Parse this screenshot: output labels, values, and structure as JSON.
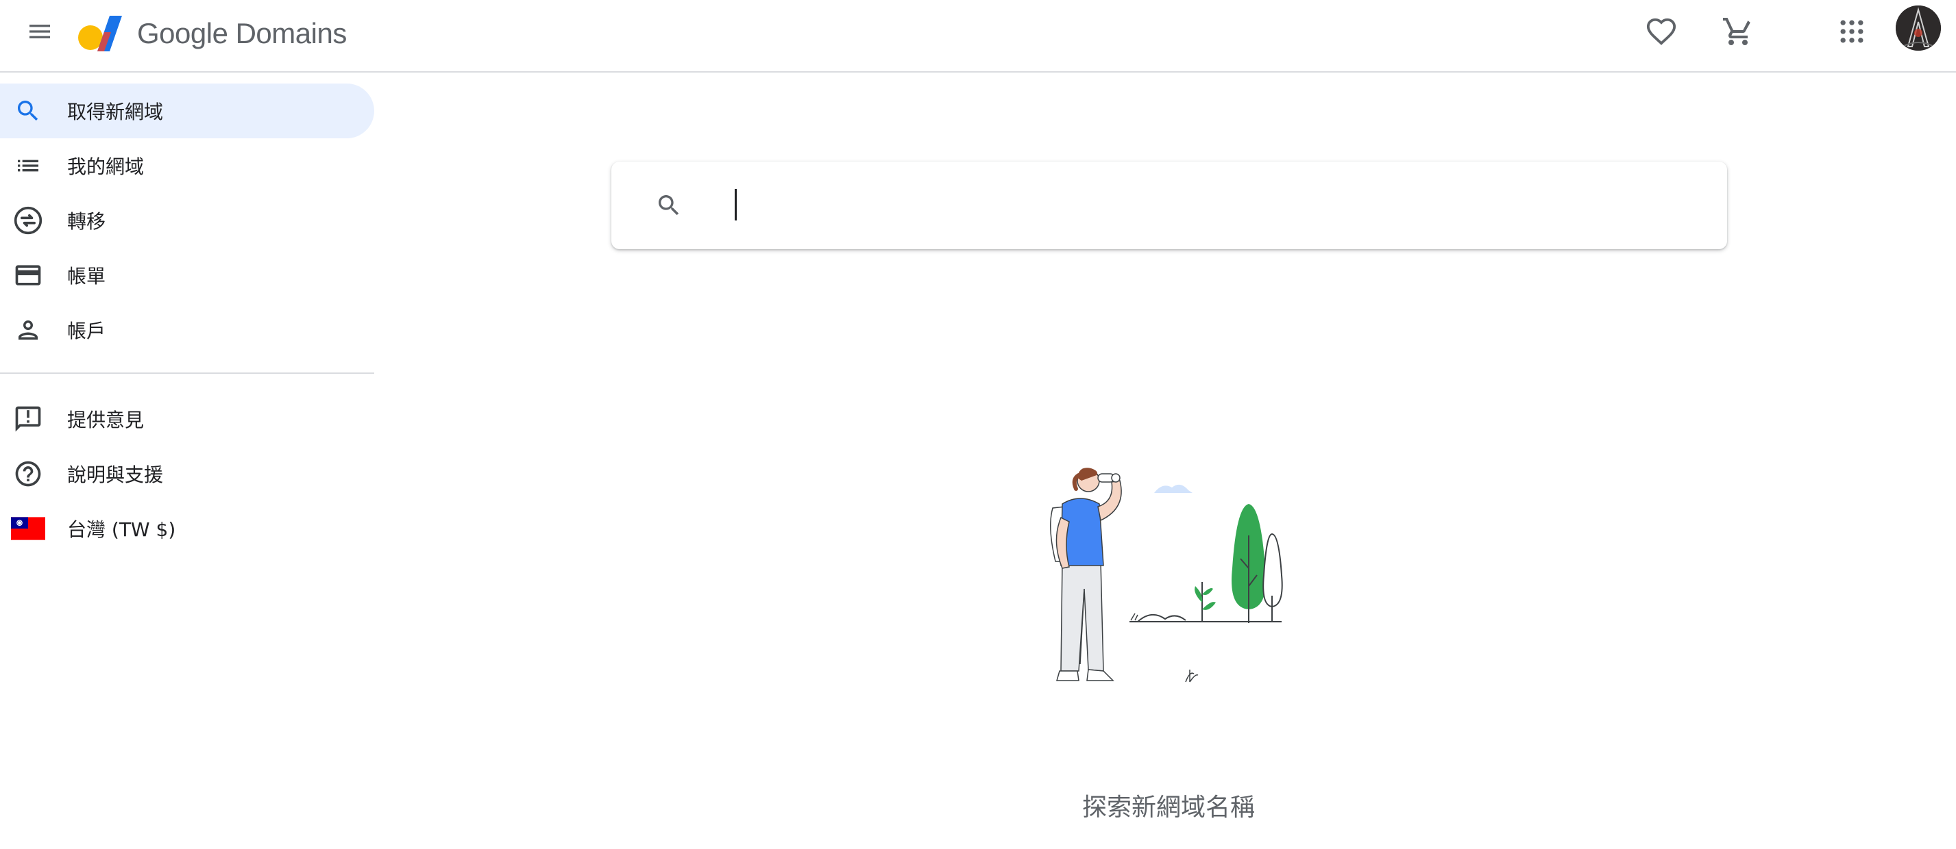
{
  "header": {
    "brand": "Google Domains",
    "icons": {
      "menu": "menu-icon",
      "favorites": "heart-icon",
      "cart": "cart-icon",
      "apps": "apps-grid-icon",
      "avatar": "avatar"
    }
  },
  "sidebar": {
    "items": [
      {
        "label": "取得新網域",
        "icon": "search-icon",
        "active": true
      },
      {
        "label": "我的網域",
        "icon": "list-icon"
      },
      {
        "label": "轉移",
        "icon": "transfer-icon"
      },
      {
        "label": "帳單",
        "icon": "credit-card-icon"
      },
      {
        "label": "帳戶",
        "icon": "person-icon"
      },
      {
        "label": "提供意見",
        "icon": "feedback-icon"
      },
      {
        "label": "說明與支援",
        "icon": "help-icon"
      },
      {
        "label": "台灣 (TW $)",
        "icon": "taiwan-flag-icon"
      }
    ]
  },
  "main": {
    "search": {
      "value": "",
      "placeholder": ""
    },
    "explore_caption": "探索新網域名稱"
  },
  "colors": {
    "accent": "#1a73e8",
    "active_bg": "#e8f0fe",
    "icon_gray": "#5f6368",
    "divider": "#dadce0",
    "tree_green": "#34a853",
    "shirt_blue": "#4285f4"
  }
}
